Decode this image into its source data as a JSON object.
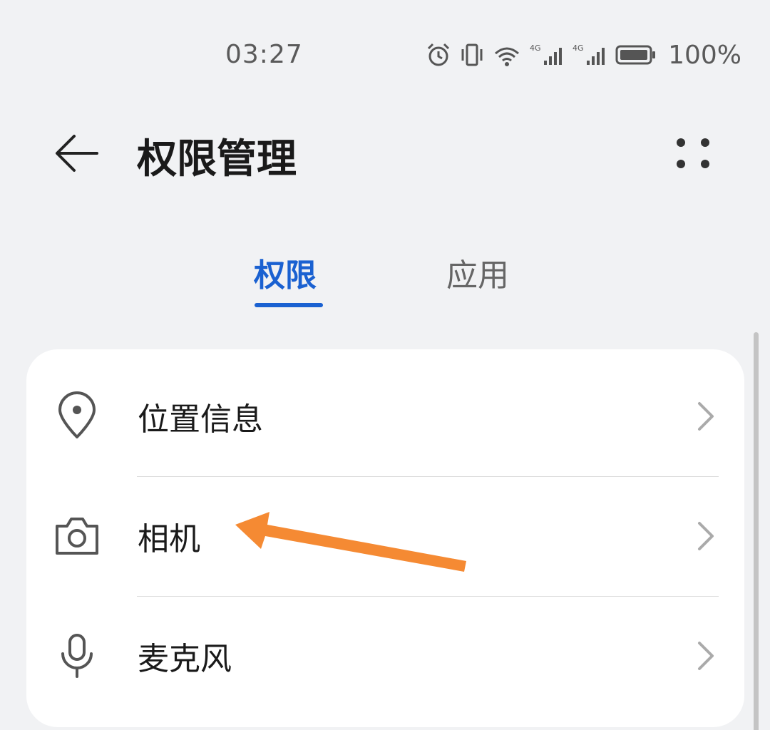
{
  "status_bar": {
    "time": "03:27",
    "battery_percent": "100%",
    "icons": [
      "alarm-icon",
      "vibrate-icon",
      "wifi-6-icon",
      "signal-4g-icon",
      "signal-4g-icon",
      "battery-icon"
    ]
  },
  "header": {
    "title": "权限管理",
    "back_icon": "arrow-left-icon",
    "more_icon": "more-dots-icon"
  },
  "tabs": [
    {
      "label": "权限",
      "active": true
    },
    {
      "label": "应用",
      "active": false
    }
  ],
  "list": {
    "items": [
      {
        "label": "位置信息",
        "icon": "location-pin-icon"
      },
      {
        "label": "相机",
        "icon": "camera-icon"
      },
      {
        "label": "麦克风",
        "icon": "microphone-icon"
      }
    ]
  },
  "colors": {
    "accent": "#1a61d1",
    "background": "#f1f2f4",
    "card": "#ffffff",
    "annotation_arrow": "#f58a33"
  }
}
